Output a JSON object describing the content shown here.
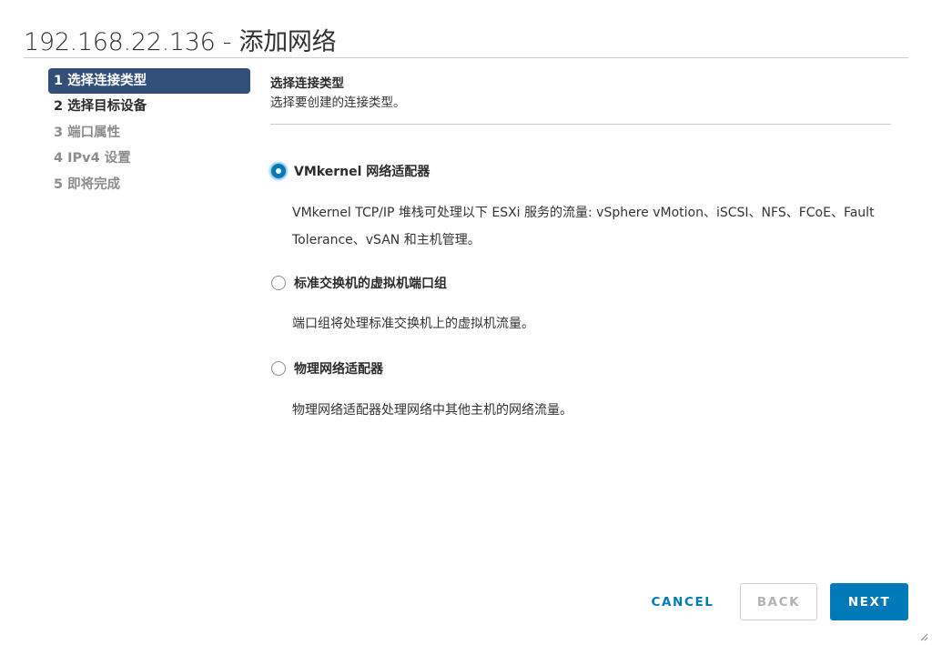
{
  "dialog": {
    "title": "192.168.22.136 - 添加网络"
  },
  "steps": [
    {
      "label": "1 选择连接类型",
      "state": "active"
    },
    {
      "label": "2 选择目标设备",
      "state": "enabled"
    },
    {
      "label": "3 端口属性",
      "state": "disabled"
    },
    {
      "label": "4 IPv4 设置",
      "state": "disabled"
    },
    {
      "label": "5 即将完成",
      "state": "disabled"
    }
  ],
  "content": {
    "title": "选择连接类型",
    "description": "选择要创建的连接类型。",
    "options": [
      {
        "label": "VMkernel 网络适配器",
        "checked": true,
        "description": "VMkernel TCP/IP 堆栈可处理以下 ESXi 服务的流量: vSphere vMotion、iSCSI、NFS、FCoE、Fault Tolerance、vSAN 和主机管理。"
      },
      {
        "label": "标准交换机的虚拟机端口组",
        "checked": false,
        "description": "端口组将处理标准交换机上的虚拟机流量。"
      },
      {
        "label": "物理网络适配器",
        "checked": false,
        "description": "物理网络适配器处理网络中其他主机的网络流量。"
      }
    ]
  },
  "footer": {
    "cancel_label": "CANCEL",
    "back_label": "BACK",
    "next_label": "NEXT"
  },
  "colors": {
    "accent": "#0079b8",
    "active_step_bg": "#314f78",
    "disabled_text": "#8c8c8c"
  },
  "icons": {
    "resize_handle": "resize-grip-icon"
  }
}
